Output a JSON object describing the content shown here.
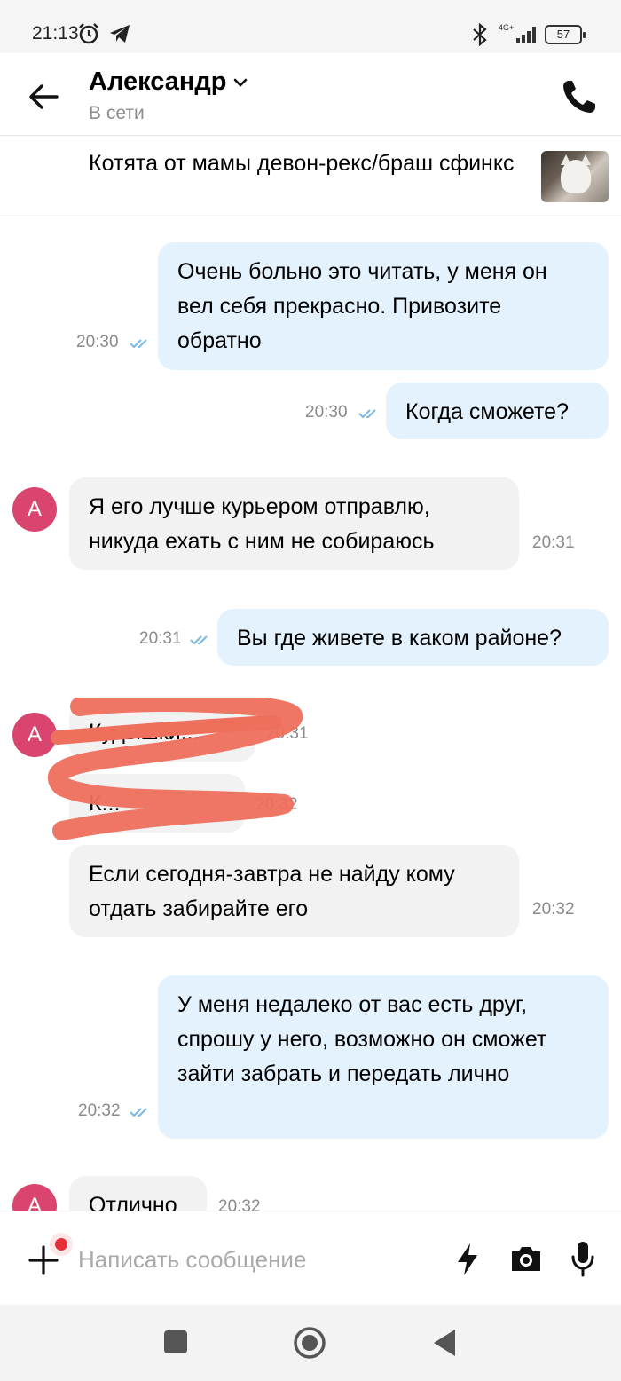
{
  "statusbar": {
    "time": "21:13",
    "network": "4G+",
    "battery": "57"
  },
  "header": {
    "name": "Александр",
    "status": "В сети"
  },
  "ad": {
    "title": "Котята от мамы девон-рекс/браш сфинкс"
  },
  "messages": [
    {
      "dir": "out",
      "text": "Очень больно это читать, у меня он вел себя прекрасно. Привозите обратно",
      "time": "20:30"
    },
    {
      "dir": "out",
      "text": "Когда сможете?",
      "time": "20:30"
    },
    {
      "dir": "in",
      "text": "Я его лучше курьером отправлю, никуда ехать с ним не собираюсь",
      "time": "20:31",
      "avatar": "А"
    },
    {
      "dir": "out",
      "text": "Вы где живете в каком районе?",
      "time": "20:31"
    },
    {
      "dir": "in",
      "text": "Кудышки...",
      "time": "20:31",
      "avatar": "А"
    },
    {
      "dir": "in",
      "text": "К...",
      "time": "20:32"
    },
    {
      "dir": "in",
      "text": "Если сегодня-завтра не найду кому отдать забирайте его",
      "time": "20:32"
    },
    {
      "dir": "out",
      "text": "У меня недалеко от вас есть друг, спрошу у него, возможно он сможет зайти забрать и передать лично",
      "time": "20:32"
    },
    {
      "dir": "in",
      "text": "Отлично",
      "time": "20:32",
      "avatar": "А"
    }
  ],
  "input": {
    "placeholder": "Написать сообщение"
  },
  "icons": {
    "back": "arrow-left-icon",
    "call": "phone-icon",
    "attach": "plus-icon",
    "quick": "lightning-icon",
    "camera": "camera-icon",
    "mic": "microphone-icon"
  },
  "colors": {
    "outgoing_bubble": "#e4f2fd",
    "incoming_bubble": "#f2f2f2",
    "avatar": "#d9456f",
    "read_ticks": "#7ab8e6",
    "scribble": "#ee6f5c"
  }
}
